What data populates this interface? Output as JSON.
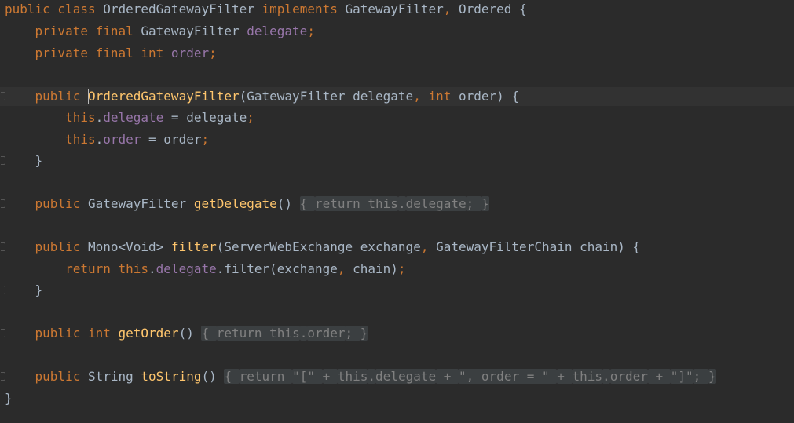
{
  "editor": {
    "language": "java",
    "colors": {
      "background": "#2b2b2b",
      "current_line": "#323232",
      "keyword": "#cc7832",
      "field": "#9876aa",
      "method": "#ffc66d",
      "string": "#6a8759",
      "text": "#a9b7c6",
      "fold_bg": "#3b3f41",
      "fold_text": "#808080"
    },
    "lines": [
      {
        "t": [
          {
            "c": "kw",
            "s": "public class "
          },
          {
            "c": "plain",
            "s": "OrderedGatewayFilter "
          },
          {
            "c": "kw",
            "s": "implements "
          },
          {
            "c": "plain",
            "s": "GatewayFilter"
          },
          {
            "c": "kw",
            "s": ", "
          },
          {
            "c": "plain",
            "s": "Ordered {"
          }
        ]
      },
      {
        "t": [
          {
            "c": "kw",
            "s": "    private final "
          },
          {
            "c": "plain",
            "s": "GatewayFilter "
          },
          {
            "c": "fld",
            "s": "delegate"
          },
          {
            "c": "kw",
            "s": ";"
          }
        ]
      },
      {
        "t": [
          {
            "c": "kw",
            "s": "    private final int "
          },
          {
            "c": "fld",
            "s": "order"
          },
          {
            "c": "kw",
            "s": ";"
          }
        ]
      },
      {
        "t": []
      },
      {
        "t": [
          {
            "c": "kw",
            "s": "    public "
          },
          {
            "c": "fn hl",
            "s": "OrderedGatewayFilter"
          },
          {
            "c": "plain",
            "s": "(GatewayFilter delegate"
          },
          {
            "c": "kw",
            "s": ", int "
          },
          {
            "c": "plain",
            "s": "order) {"
          }
        ]
      },
      {
        "t": [
          {
            "c": "kw",
            "s": "        this"
          },
          {
            "c": "plain",
            "s": "."
          },
          {
            "c": "fld",
            "s": "delegate"
          },
          {
            "c": "plain",
            "s": " = delegate"
          },
          {
            "c": "kw",
            "s": ";"
          }
        ]
      },
      {
        "t": [
          {
            "c": "kw",
            "s": "        this"
          },
          {
            "c": "plain",
            "s": "."
          },
          {
            "c": "fld",
            "s": "order"
          },
          {
            "c": "plain",
            "s": " = order"
          },
          {
            "c": "kw",
            "s": ";"
          }
        ]
      },
      {
        "t": [
          {
            "c": "plain",
            "s": "    }"
          }
        ]
      },
      {
        "t": []
      },
      {
        "t": [
          {
            "c": "kw",
            "s": "    public "
          },
          {
            "c": "plain",
            "s": "GatewayFilter "
          },
          {
            "c": "fn",
            "s": "getDelegate"
          },
          {
            "c": "plain",
            "s": "() "
          },
          {
            "c": "fold",
            "s": "{ "
          },
          {
            "c": "kw fold",
            "s": "return this"
          },
          {
            "c": "plain fold",
            "s": "."
          },
          {
            "c": "fld fold",
            "s": "delegate"
          },
          {
            "c": "kw fold",
            "s": "; "
          },
          {
            "c": "fold",
            "s": "}"
          }
        ]
      },
      {
        "t": []
      },
      {
        "t": [
          {
            "c": "kw",
            "s": "    public "
          },
          {
            "c": "plain",
            "s": "Mono<Void> "
          },
          {
            "c": "fn",
            "s": "filter"
          },
          {
            "c": "plain",
            "s": "(ServerWebExchange exchange"
          },
          {
            "c": "kw",
            "s": ", "
          },
          {
            "c": "plain",
            "s": "GatewayFilterChain chain) {"
          }
        ]
      },
      {
        "t": [
          {
            "c": "kw",
            "s": "        return this"
          },
          {
            "c": "plain",
            "s": "."
          },
          {
            "c": "fld",
            "s": "delegate"
          },
          {
            "c": "plain",
            "s": ".filter(exchange"
          },
          {
            "c": "kw",
            "s": ", "
          },
          {
            "c": "plain",
            "s": "chain)"
          },
          {
            "c": "kw",
            "s": ";"
          }
        ]
      },
      {
        "t": [
          {
            "c": "plain",
            "s": "    }"
          }
        ]
      },
      {
        "t": []
      },
      {
        "t": [
          {
            "c": "kw",
            "s": "    public int "
          },
          {
            "c": "fn",
            "s": "getOrder"
          },
          {
            "c": "plain",
            "s": "() "
          },
          {
            "c": "fold",
            "s": "{ "
          },
          {
            "c": "kw fold",
            "s": "return this"
          },
          {
            "c": "plain fold",
            "s": "."
          },
          {
            "c": "fld fold",
            "s": "order"
          },
          {
            "c": "kw fold",
            "s": "; "
          },
          {
            "c": "fold",
            "s": "}"
          }
        ]
      },
      {
        "t": []
      },
      {
        "t": [
          {
            "c": "kw",
            "s": "    public "
          },
          {
            "c": "plain",
            "s": "String "
          },
          {
            "c": "fn",
            "s": "toString"
          },
          {
            "c": "plain",
            "s": "() "
          },
          {
            "c": "fold",
            "s": "{ "
          },
          {
            "c": "kw fold",
            "s": "return "
          },
          {
            "c": "str fold",
            "s": "\"[\" "
          },
          {
            "c": "plain fold",
            "s": "+ "
          },
          {
            "c": "kw fold",
            "s": "this"
          },
          {
            "c": "plain fold",
            "s": "."
          },
          {
            "c": "fld fold",
            "s": "delegate"
          },
          {
            "c": "plain fold",
            "s": " + "
          },
          {
            "c": "str fold",
            "s": "\", order = \" "
          },
          {
            "c": "plain fold",
            "s": "+ "
          },
          {
            "c": "kw fold",
            "s": "this"
          },
          {
            "c": "plain fold",
            "s": "."
          },
          {
            "c": "fld fold",
            "s": "order"
          },
          {
            "c": "plain fold",
            "s": " + "
          },
          {
            "c": "str fold",
            "s": "\"]\""
          },
          {
            "c": "kw fold",
            "s": "; "
          },
          {
            "c": "fold",
            "s": "}"
          }
        ]
      },
      {
        "t": [
          {
            "c": "plain",
            "s": "}"
          }
        ]
      }
    ]
  }
}
